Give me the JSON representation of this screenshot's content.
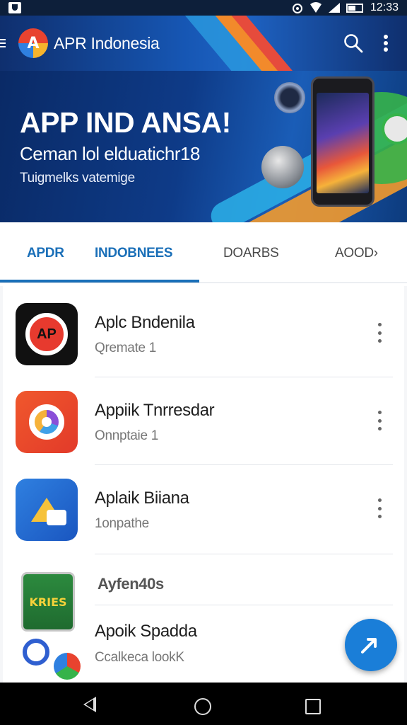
{
  "status_bar": {
    "time": "12:33"
  },
  "app_bar": {
    "title": "APR Indonesia",
    "logo_text": "A"
  },
  "banner": {
    "title": "APP IND ANSA!",
    "subtitle": "Ceman lol elduatichr18",
    "tagline": "Tuigmelks vatemige"
  },
  "tabs": [
    "APDR",
    "INDOBNEES",
    "DOARBS",
    "AOOD›"
  ],
  "list": {
    "items": [
      {
        "title": "Aplc Bndenila",
        "subtitle": "Qremate 1",
        "icon": "ap-app-icon",
        "icon_text": "AP"
      },
      {
        "title": "Appiik Tnrresdar",
        "subtitle": "Onnptaie 1",
        "icon": "orange-ring-app-icon"
      },
      {
        "title": "Aplaik Biiana",
        "subtitle": "1onpathe",
        "icon": "blue-shape-app-icon"
      }
    ],
    "section_label": "Ayfen40s",
    "section_badge_text": "KRIES",
    "last_item": {
      "title": "Apoik Spadda",
      "subtitle": "Ccalkeca lookK"
    }
  },
  "colors": {
    "accent": "#1a6fb8",
    "fab": "#1a7ed8",
    "app_bar": "#1656b3"
  }
}
